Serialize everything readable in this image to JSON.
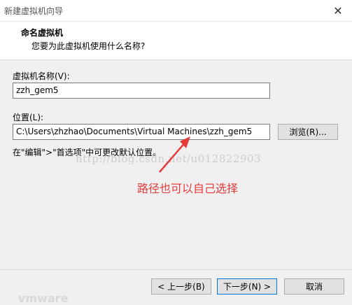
{
  "window": {
    "title": "新建虚拟机向导",
    "close_glyph": "✕"
  },
  "header": {
    "title": "命名虚拟机",
    "subtitle": "您要为此虚拟机使用什么名称?"
  },
  "form": {
    "name_label": "虚拟机名称(V):",
    "name_value": "zzh_gem5",
    "location_label": "位置(L):",
    "location_value": "C:\\Users\\zhzhao\\Documents\\Virtual Machines\\zzh_gem5",
    "browse_label": "浏览(R)...",
    "hint": "在\"编辑\">\"首选项\"中可更改默认位置。"
  },
  "overlay": {
    "watermark": "http://blog.csdn.net/u012822903",
    "annotation": "路径也可以自己选择",
    "annotation_color": "#e53b3b"
  },
  "footer": {
    "back_label": "< 上一步(B)",
    "next_label": "下一步(N) >",
    "cancel_label": "取消",
    "ghost_text": "vmware"
  },
  "icons": {
    "close": "close-icon",
    "arrow": "arrow-icon"
  }
}
